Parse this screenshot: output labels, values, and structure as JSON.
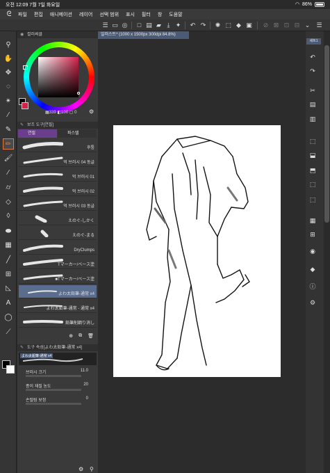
{
  "status": {
    "time": "오전 12:09",
    "date": "7월 7일 화요일",
    "battery": "86%",
    "battery_level": 0.86
  },
  "menu": {
    "items": [
      "파일",
      "편집",
      "애니메이션",
      "레이어",
      "선택 범위",
      "표시",
      "필터",
      "창",
      "도움말"
    ]
  },
  "color_panel": {
    "title": "컬러써클",
    "hsv_text": "339",
    "val1": "100",
    "val2": "0",
    "accent": "#d2224a"
  },
  "brush_panel": {
    "title": "보조 도구[연필]",
    "tab_pencil": "연필",
    "tab_pastel": "파스텔",
    "items": [
      {
        "name": "후퉁",
        "sel": false
      },
      {
        "name": "억 브러시 04 동글",
        "sel": false
      },
      {
        "name": "억 브러시 01",
        "sel": false
      },
      {
        "name": "억 브러시 02",
        "sel": false
      },
      {
        "name": "억 브러시 03 동글",
        "sel": false
      },
      {
        "name": "えのぐ-しかく",
        "sel": false
      },
      {
        "name": "えのぐ-まる",
        "sel": false
      },
      {
        "name": "DryClumps",
        "sel": false
      },
      {
        "name": "Tマーカー/ベース塗",
        "sel": false
      },
      {
        "name": "■Tマーカー/ベース塗",
        "sel": false
      },
      {
        "name": "よわ太鉛筆-通常 x4",
        "sel": true
      },
      {
        "name": "よわ太鉛筆-通常 - 通常 x4",
        "sel": false
      },
      {
        "name": "鉛筆削鋼り消し",
        "sel": false
      }
    ]
  },
  "property_panel": {
    "title": "도구 속성[よわ太鉛筆-通常 x4]",
    "preset_name": "よわ太鉛筆-通常 x4",
    "brush_size_label": "브러시 크기",
    "brush_size": "11.0",
    "paper_texture_label": "종이 재질 농도",
    "paper_texture": "20",
    "stabilization_label": "손떨림 보정",
    "stabilization": "0"
  },
  "document": {
    "tab": "일러스트* (1000 x 1500px 300dpi 84.8%)"
  },
  "right_panel": {
    "tab": "세트1"
  }
}
